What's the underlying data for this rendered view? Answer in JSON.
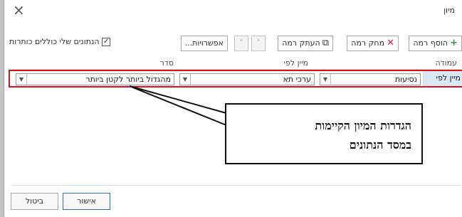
{
  "window": {
    "title": "מיון",
    "close_icon": "close-icon"
  },
  "toolbar": {
    "add_level_label": "הוסף רמה",
    "delete_level_label": "מחק רמה",
    "copy_level_label": "העתק רמה",
    "options_label": "אפשרויות...",
    "has_headers_label": "הנתונים שלי כוללים כותרות",
    "has_headers_checked": "✓",
    "move_up_icon": "˄",
    "move_down_icon": "˅"
  },
  "columns": {
    "column_header": "עמודה",
    "sort_on_header": "מיין לפי",
    "order_header": "סדר"
  },
  "sort_row": {
    "label": "מיין לפי",
    "column_value": "נסיעות",
    "sort_on_value": "ערכי תא",
    "order_value": "מהגדול ביותר לקטן ביותר"
  },
  "callout": {
    "line1": "הגדרות המיון הקיימות",
    "line2": "במסד הנתונים"
  },
  "footer": {
    "ok_label": "אישור",
    "cancel_label": "ביטול"
  },
  "colors": {
    "highlight_border": "#d9141f",
    "add_green": "#2d9b3d",
    "delete_red": "#d8262d"
  }
}
